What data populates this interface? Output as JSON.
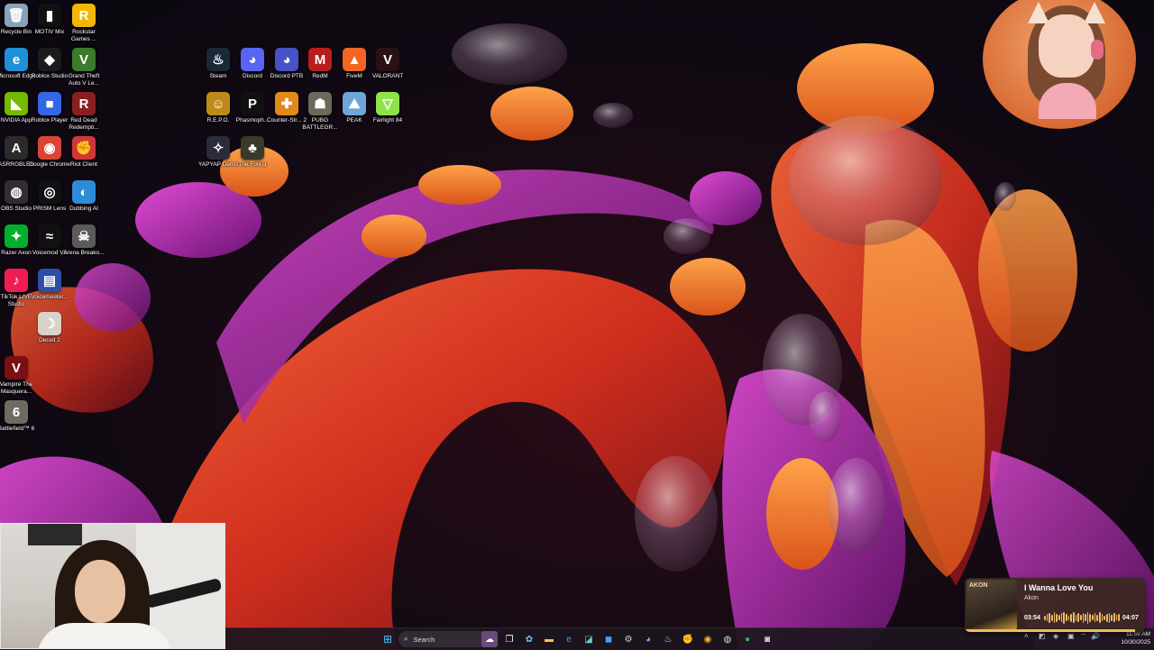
{
  "desktop": {
    "icons": [
      {
        "label": "Recycle Bin",
        "glyph": "🗑",
        "color": "#8aa2b8",
        "icon": "recycle-bin-icon"
      },
      {
        "label": "MOTIV Mix",
        "glyph": "▮",
        "color": "#111111",
        "icon": "motiv-mix-icon"
      },
      {
        "label": "Rockstar Games ...",
        "glyph": "R",
        "color": "#f2b705",
        "icon": "rockstar-icon"
      },
      {
        "label": "Microsoft Edge",
        "glyph": "e",
        "color": "#1f8fd6",
        "icon": "edge-icon"
      },
      {
        "label": "Roblox Studio",
        "glyph": "◆",
        "color": "#1b1b1b",
        "icon": "roblox-studio-icon"
      },
      {
        "label": "Grand Theft Auto V Le...",
        "glyph": "V",
        "color": "#3c7a2c",
        "icon": "gta-icon"
      },
      {
        "label": "NVIDIA App",
        "glyph": "◣",
        "color": "#76b900",
        "icon": "nvidia-icon"
      },
      {
        "label": "Roblox Player",
        "glyph": "■",
        "color": "#3566e6",
        "icon": "roblox-player-icon"
      },
      {
        "label": "Red Dead Redempti...",
        "glyph": "R",
        "color": "#8a1f1f",
        "icon": "red-dead-icon"
      },
      {
        "label": "ASRRGBLED",
        "glyph": "A",
        "color": "#2b2b2b",
        "icon": "asrrgbled-icon"
      },
      {
        "label": "Google Chrome",
        "glyph": "◉",
        "color": "#db4437",
        "icon": "chrome-icon"
      },
      {
        "label": "Riot Client",
        "glyph": "✊",
        "color": "#d13639",
        "icon": "riot-client-icon"
      },
      {
        "label": "OBS Studio",
        "glyph": "◍",
        "color": "#302e31",
        "icon": "obs-icon"
      },
      {
        "label": "PRISM Lens",
        "glyph": "◎",
        "color": "#111111",
        "icon": "prism-lens-icon"
      },
      {
        "label": "Dubbing AI",
        "glyph": "◐",
        "color": "#2d8bd8",
        "icon": "dubbing-ai-icon"
      },
      {
        "label": "Razer Axon",
        "glyph": "✦",
        "color": "#00b02c",
        "icon": "razer-axon-icon"
      },
      {
        "label": "Voicemod V3",
        "glyph": "≈",
        "color": "#111111",
        "icon": "voicemod-icon"
      },
      {
        "label": "Arena Breako...",
        "glyph": "☠",
        "color": "#5b5b5b",
        "icon": "arena-breakout-icon"
      },
      {
        "label": "TikTok LIVE Studio",
        "glyph": "♪",
        "color": "#ee1d52",
        "icon": "tiktok-live-icon"
      },
      {
        "label": "Voicemeeter...",
        "glyph": "▤",
        "color": "#2c4ea8",
        "icon": "voicemeeter-icon"
      },
      {
        "label": "Deceit 2",
        "glyph": "☽",
        "color": "#d8d2c8",
        "icon": "deceit-icon"
      },
      {
        "label": "Vampire The Masquera...",
        "glyph": "V",
        "color": "#7a0f14",
        "icon": "vampire-icon"
      },
      {
        "label": "Battlefield™ 6",
        "glyph": "6",
        "color": "#6f6a62",
        "icon": "battlefield-icon"
      },
      {
        "label": "Steam",
        "glyph": "♨",
        "color": "#1b2838",
        "icon": "steam-icon"
      },
      {
        "label": "Discord",
        "glyph": "◕",
        "color": "#5865f2",
        "icon": "discord-icon"
      },
      {
        "label": "Discord PTB",
        "glyph": "◕",
        "color": "#4752c4",
        "icon": "discord-ptb-icon"
      },
      {
        "label": "RedM",
        "glyph": "M",
        "color": "#b81e1e",
        "icon": "redm-icon"
      },
      {
        "label": "FiveM",
        "glyph": "▲",
        "color": "#f26522",
        "icon": "fivem-icon"
      },
      {
        "label": "VALORANT",
        "glyph": "V",
        "color": "#2a1115",
        "icon": "valorant-icon"
      },
      {
        "label": "R.E.P.O.",
        "glyph": "☺",
        "color": "#c08a1a",
        "icon": "repo-icon"
      },
      {
        "label": "Phasmoph...",
        "glyph": "P",
        "color": "#111111",
        "icon": "phasmophobia-icon"
      },
      {
        "label": "Counter-Str... 2",
        "glyph": "✚",
        "color": "#e08a19",
        "icon": "cs2-icon"
      },
      {
        "label": "PUBG BATTLEGR...",
        "glyph": "☗",
        "color": "#6a6a5a",
        "icon": "pubg-icon"
      },
      {
        "label": "PEAK",
        "glyph": "⛰",
        "color": "#6fa6d8",
        "icon": "peak-icon"
      },
      {
        "label": "Fairlight 84",
        "glyph": "▽",
        "color": "#8fe24a",
        "icon": "fairlight-icon"
      },
      {
        "label": "YAPYAP Demo",
        "glyph": "✧",
        "color": "#2b2b3b",
        "icon": "yapyap-icon"
      },
      {
        "label": "The Forest",
        "glyph": "♣",
        "color": "#3a3a2a",
        "icon": "the-forest-icon"
      }
    ]
  },
  "music_widget": {
    "song": "I Wanna Love You",
    "artist": "Akon",
    "current_time": "03:54",
    "total_time": "04:07",
    "album_art_text": "AKON",
    "progress_fraction": 0.947
  },
  "taskbar": {
    "search_label": "Search",
    "clock_time": "11:59 AM",
    "clock_date": "10/30/2025",
    "accent": "#f1b860"
  }
}
